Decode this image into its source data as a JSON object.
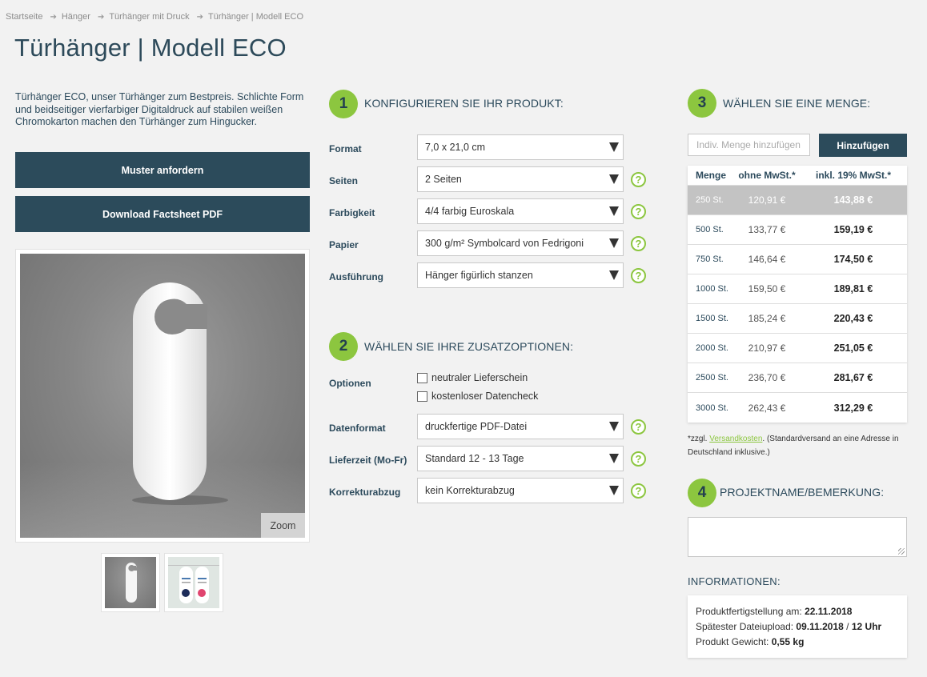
{
  "breadcrumb": [
    "Startseite",
    "Hänger",
    "Türhänger mit Druck",
    "Türhänger | Modell ECO"
  ],
  "page_title": "Türhänger | Modell ECO",
  "description": "Türhänger ECO, unser Türhänger zum Bestpreis. Schlichte Form und beidseitiger vierfarbiger Digitaldruck auf stabilen weißen Chromokarton machen den Türhänger zum Hingucker.",
  "buttons": {
    "sample": "Muster anfordern",
    "factsheet": "Download Factsheet PDF",
    "zoom": "Zoom",
    "add": "Hinzufügen"
  },
  "step1": {
    "number": "1",
    "title": "KONFIGURIEREN SIE IHR PRODUKT:",
    "rows": [
      {
        "label": "Format",
        "value": "7,0 x 21,0 cm"
      },
      {
        "label": "Seiten",
        "value": "2 Seiten"
      },
      {
        "label": "Farbigkeit",
        "value": "4/4 farbig Euroskala"
      },
      {
        "label": "Papier",
        "value": "300 g/m² Symbolcard von Fedrigoni"
      },
      {
        "label": "Ausführung",
        "value": "Hänger figürlich stanzen"
      }
    ]
  },
  "step2": {
    "number": "2",
    "title": "WÄHLEN SIE IHRE ZUSATZOPTIONEN:",
    "options_label": "Optionen",
    "options": [
      "neutraler Lieferschein",
      "kostenloser Datencheck"
    ],
    "rows": [
      {
        "label": "Datenformat",
        "value": "druckfertige PDF-Datei"
      },
      {
        "label": "Lieferzeit (Mo-Fr)",
        "value": "Standard 12 - 13 Tage"
      },
      {
        "label": "Korrekturabzug",
        "value": "kein Korrekturabzug"
      }
    ]
  },
  "step3": {
    "number": "3",
    "title": "WÄHLEN SIE EINE MENGE:",
    "qty_placeholder": "Indiv. Menge hinzufügen",
    "table_headers": [
      "Menge",
      "ohne MwSt.*",
      "inkl. 19% MwSt.*"
    ],
    "rows": [
      [
        "250 St.",
        "120,91 €",
        "143,88 €"
      ],
      [
        "500 St.",
        "133,77 €",
        "159,19 €"
      ],
      [
        "750 St.",
        "146,64 €",
        "174,50 €"
      ],
      [
        "1000 St.",
        "159,50 €",
        "189,81 €"
      ],
      [
        "1500 St.",
        "185,24 €",
        "220,43 €"
      ],
      [
        "2000 St.",
        "210,97 €",
        "251,05 €"
      ],
      [
        "2500 St.",
        "236,70 €",
        "281,67 €"
      ],
      [
        "3000 St.",
        "262,43 €",
        "312,29 €"
      ]
    ],
    "selected_row": 0,
    "note_prefix": "*zzgl. ",
    "note_link": "Versandkosten",
    "note_suffix": ". (Standardversand an eine Adresse in Deutschland inklusive.)"
  },
  "step4": {
    "number": "4",
    "title": "PROJEKTNAME/BEMERKUNG:"
  },
  "info": {
    "heading": "INFORMATIONEN:",
    "line1_label": "Produktfertigstellung am: ",
    "line1_value": "22.11.2018",
    "line2_label": "Spätester Dateiupload: ",
    "line2_value": "09.11.2018",
    "line2_sep": " / ",
    "line2_time": "12 Uhr",
    "line3_label": "Produkt Gewicht: ",
    "line3_value": "0,55 kg"
  },
  "colors": {
    "accent_green": "#8cc63f",
    "dark_blue": "#2c4b5b",
    "background": "#f2f2f2"
  }
}
